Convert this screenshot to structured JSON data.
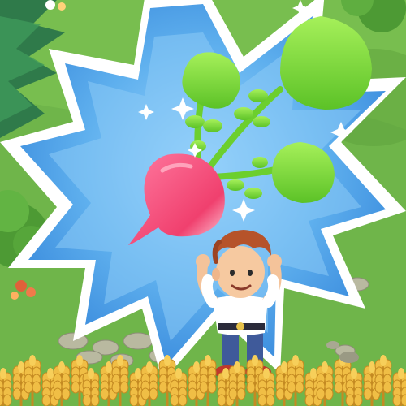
{
  "scene": {
    "description_visible_text": "",
    "reward_item": "radish-icon",
    "character": "farmer-boy",
    "colors": {
      "grass": "#6fb54a",
      "grass_light": "#8fcc5a",
      "burst_outer": "#ffffff",
      "burst_mid": "#7cc3f2",
      "burst_inner": "#4aa3ea",
      "radish_body": "#f0507a",
      "radish_leaf": "#7fd93a",
      "wheat": "#e9b43a",
      "shirt": "#ffffff",
      "hair": "#b6532a",
      "pants": "#3f5a9a"
    },
    "icons": [
      "radish-icon",
      "sparkle-icon",
      "wheat-icon",
      "tree-icon",
      "bush-icon",
      "flower-icon",
      "stone-path-icon"
    ]
  }
}
